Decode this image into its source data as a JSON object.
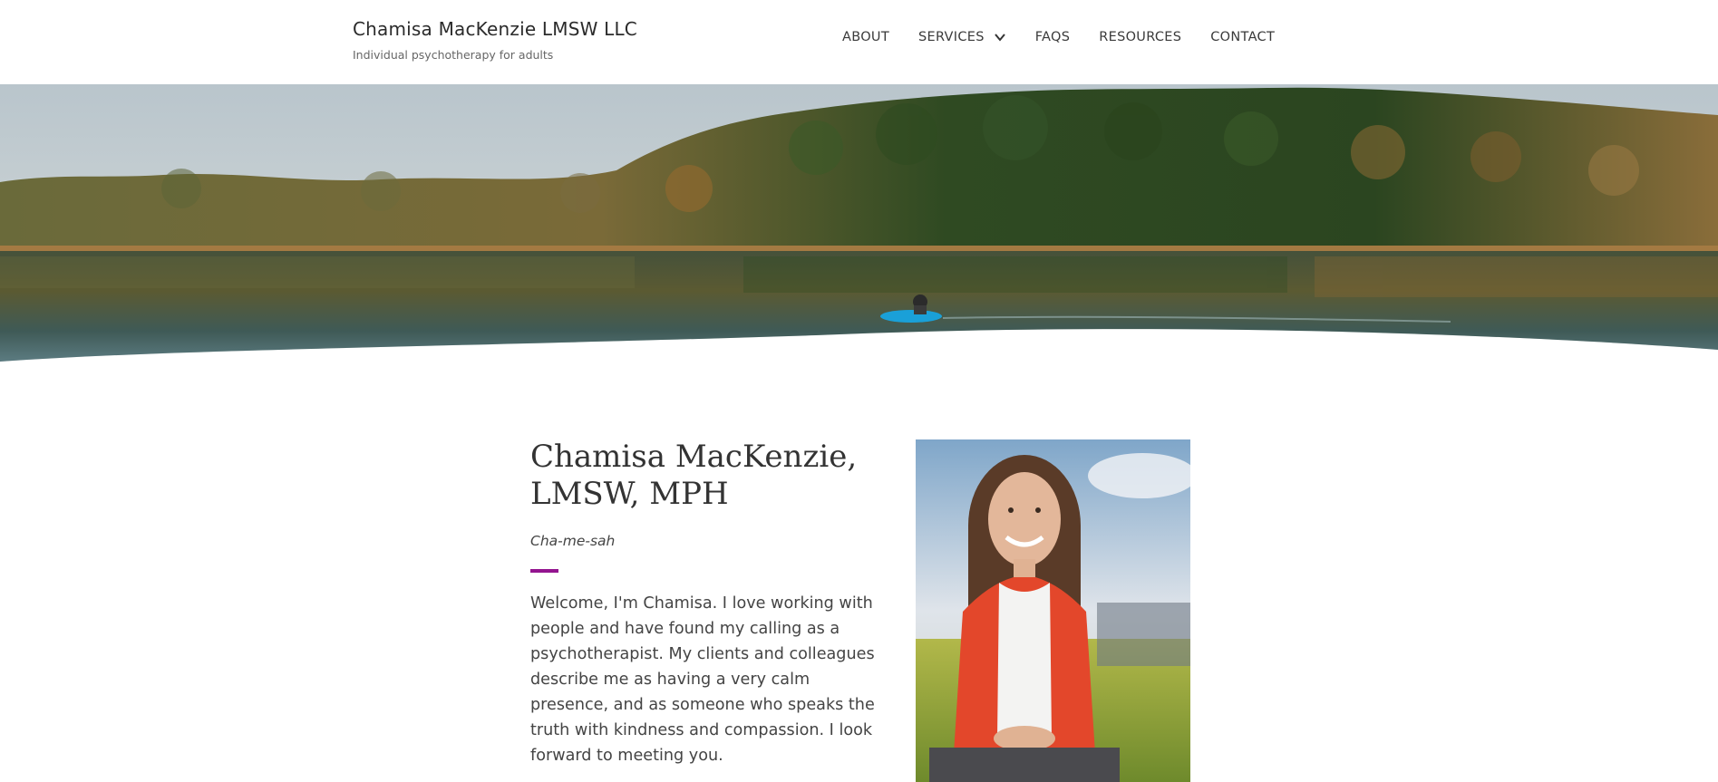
{
  "header": {
    "site_title": "Chamisa MacKenzie LMSW LLC",
    "tagline": "Individual psychotherapy for adults"
  },
  "nav": {
    "items": [
      {
        "label": "ABOUT"
      },
      {
        "label": "SERVICES",
        "icon": "chevron-down-icon"
      },
      {
        "label": "FAQS"
      },
      {
        "label": "RESOURCES"
      },
      {
        "label": "CONTACT"
      }
    ]
  },
  "hero": {
    "image": "lake-autumn-kayak-photo"
  },
  "intro": {
    "heading": "Chamisa MacKenzie, LMSW, MPH",
    "pronunciation": "Cha-me-sah",
    "body": "Welcome, I'm Chamisa. I love working with people and have found my calling as a psychotherapist. My clients and colleagues describe me as having a very calm presence, and as someone who speaks the truth with kindness and compassion. I look forward to meeting you.",
    "accent_color": "#93148f",
    "portrait_image": "portrait-photo"
  }
}
